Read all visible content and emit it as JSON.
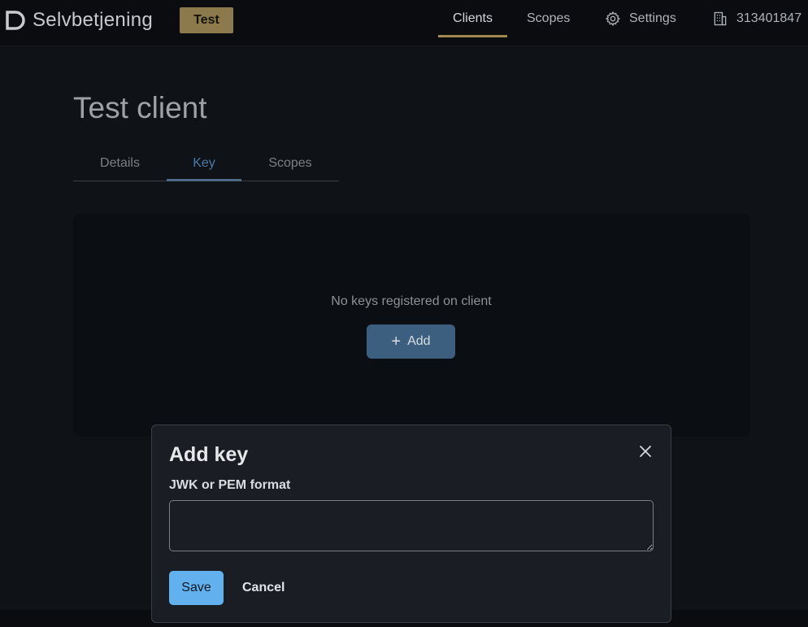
{
  "header": {
    "app_name": "Selvbetjening",
    "environment_badge": "Test",
    "nav": {
      "clients": "Clients",
      "scopes": "Scopes",
      "settings": "Settings",
      "organization": "313401847"
    },
    "icons": {
      "logo": "logo-mark-icon",
      "settings": "gear-icon",
      "organization": "building-icon"
    },
    "colors": {
      "badge": "#8c7a4c",
      "active_nav_underline": "#a08a50"
    }
  },
  "main": {
    "title": "Test client",
    "tabs": [
      {
        "label": "Details",
        "active": false
      },
      {
        "label": "Key",
        "active": true
      },
      {
        "label": "Scopes",
        "active": false
      }
    ],
    "empty_state": {
      "message": "No keys registered on client",
      "add_button": "Add",
      "add_icon": "plus-icon"
    }
  },
  "modal": {
    "title": "Add key",
    "close_icon": "close-icon",
    "field_label": "JWK or PEM format",
    "field_value": "",
    "save_label": "Save",
    "cancel_label": "Cancel",
    "colors": {
      "save_button": "#63b0ef"
    }
  }
}
